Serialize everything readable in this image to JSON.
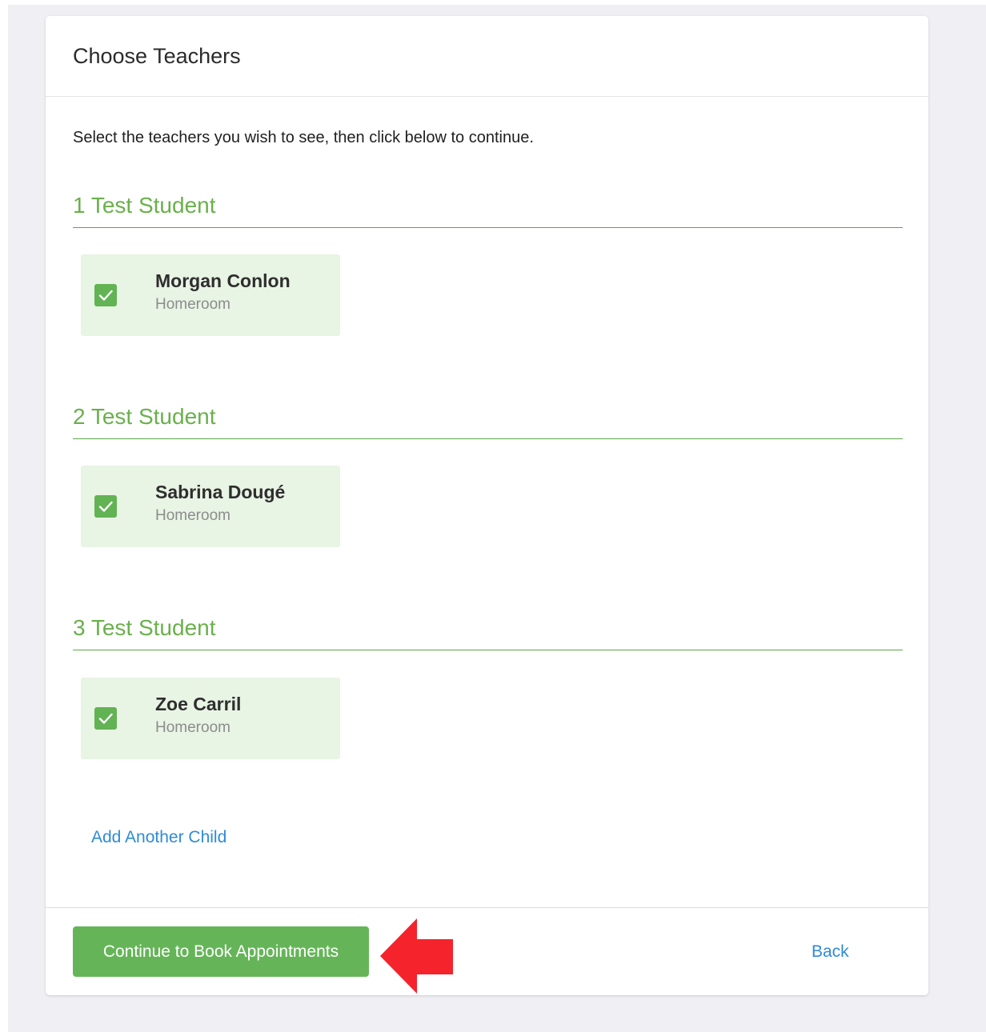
{
  "page": {
    "title": "Choose Teachers",
    "instructions": "Select the teachers you wish to see, then click below to continue."
  },
  "students": [
    {
      "heading": "1 Test Student",
      "teachers": [
        {
          "name": "Morgan Conlon",
          "role": "Homeroom",
          "checked": true
        }
      ]
    },
    {
      "heading": "2 Test Student",
      "teachers": [
        {
          "name": "Sabrina Dougé",
          "role": "Homeroom",
          "checked": true
        }
      ]
    },
    {
      "heading": "3 Test Student",
      "teachers": [
        {
          "name": "Zoe Carril",
          "role": "Homeroom",
          "checked": true
        }
      ]
    }
  ],
  "actions": {
    "add_child_label": "Add Another Child",
    "continue_label": "Continue to Book Appointments",
    "back_label": "Back"
  },
  "colors": {
    "accent_green": "#65b558",
    "heading_green": "#6ab04c",
    "teacher_card_bg": "#e8f4e4",
    "link_blue": "#2f8bd6",
    "annotation_red": "#f5232b"
  },
  "icons": {
    "checkbox": "checkmark-icon",
    "annotation": "red-arrow-left-icon"
  }
}
